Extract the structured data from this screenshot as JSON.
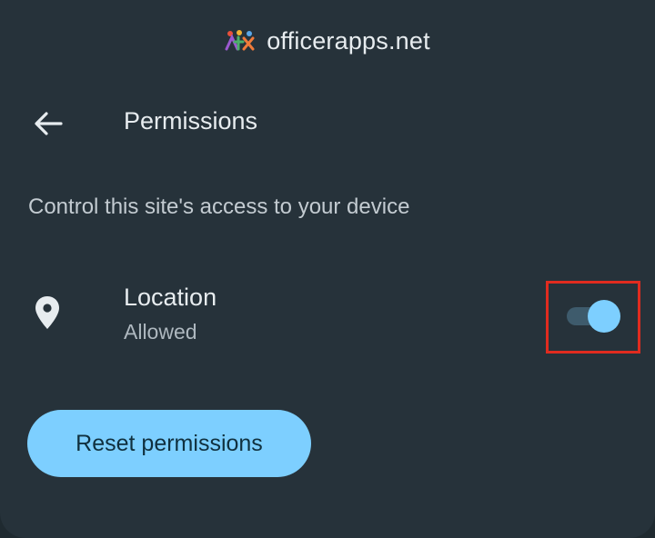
{
  "site": {
    "name": "officerapps.net",
    "logo_icon": "site-favicon"
  },
  "header": {
    "back_icon": "arrow-back-icon",
    "title": "Permissions"
  },
  "description": "Control this site's access to your device",
  "permissions": [
    {
      "icon": "location-pin-icon",
      "name": "Location",
      "status": "Allowed",
      "enabled": true
    }
  ],
  "actions": {
    "reset_label": "Reset permissions"
  },
  "colors": {
    "background": "#26323a",
    "accent": "#7dcfff",
    "toggle_track": "#3e5b6c",
    "highlight": "#e02b1f",
    "text_primary": "#e7ecef",
    "text_secondary": "#aeb8bf"
  }
}
